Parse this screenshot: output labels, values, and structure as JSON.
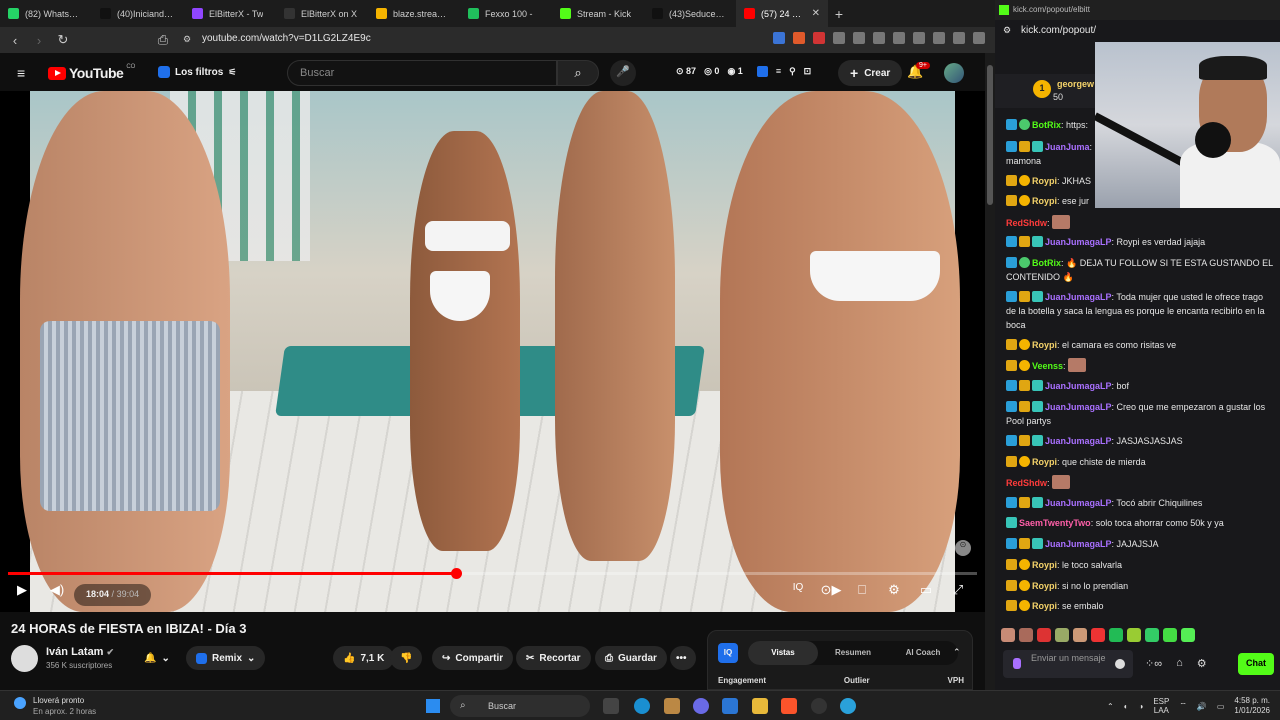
{
  "browser": {
    "tabs": [
      {
        "label": "(82) WhatsApp",
        "color": "#25d366"
      },
      {
        "label": "(40)Iniciando mi",
        "color": "#111111"
      },
      {
        "label": "ElBitterX - Tw",
        "color": "#9146ff"
      },
      {
        "label": "ElBitterX on X",
        "color": "#333333"
      },
      {
        "label": "blaze.stream/stre",
        "color": "#f5b400"
      },
      {
        "label": "Fexxo 100 -",
        "color": "#20c05c"
      },
      {
        "label": "Stream - Kick",
        "color": "#53fc18"
      },
      {
        "label": "(43)SeduceLaVid",
        "color": "#111111"
      },
      {
        "label": "(57) 24 HOR",
        "color": "#ff0000"
      }
    ],
    "new_tab": "+",
    "url": "youtube.com/watch?v=D1LG2LZ4E9c",
    "window_controls": [
      "–",
      "☐",
      "✕"
    ]
  },
  "youtube": {
    "logo_text": "YouTube",
    "logo_country": "CO",
    "filters_label": "Los filtros",
    "search_placeholder": "Buscar",
    "stats": {
      "views": "87",
      "zero": "0",
      "one": "1"
    },
    "create_label": "Crear",
    "notif_badge": "9+",
    "video": {
      "time_current": "18:04",
      "time_total": "39:04",
      "progress": 0.4625
    },
    "title": "24 HORAS de FIESTA en IBIZA! - Día 3",
    "channel": {
      "name": "Iván Latam",
      "subs": "356 K suscriptores"
    },
    "remix_label": "Remix",
    "likes": "7,1 K",
    "share_label": "Compartir",
    "clip_label": "Recortar",
    "save_label": "Guardar",
    "iq_panel": {
      "logo": "IQ",
      "tabs": [
        "Vistas",
        "Resumen",
        "AI Coach"
      ],
      "active_tab": "Vistas",
      "columns": [
        "Engagement",
        "Outlier",
        "VPH"
      ]
    }
  },
  "chat": {
    "popout_url": "kick.com/popout/elbitt",
    "popout_url2": "kick.com/popout/",
    "pinned": {
      "coin": "1",
      "user": "georgew",
      "value": "50"
    },
    "messages": [
      {
        "badges": [
          "b-blue",
          "b-green"
        ],
        "user": "BotRix",
        "user_color": "#53fc18",
        "text": "https:"
      },
      {
        "badges": [
          "b-blue",
          "b-gold",
          "b-teal"
        ],
        "user": "JuanJuma",
        "user_color": "#a970ff",
        "text": ""
      },
      {
        "badges": [],
        "user": "",
        "user_color": "#ffffff",
        "text": "mamona"
      },
      {
        "badges": [
          "b-gold",
          "b-coin"
        ],
        "user": "Roypi",
        "user_color": "#f5d36a",
        "text": "JKHAS"
      },
      {
        "badges": [
          "b-gold",
          "b-coin"
        ],
        "user": "Roypi",
        "user_color": "#f5d36a",
        "text": "ese jur"
      },
      {
        "badges": [],
        "user": "RedShdw",
        "user_color": "#ff3b3b",
        "text": "",
        "emote": true
      },
      {
        "badges": [
          "b-blue",
          "b-gold",
          "b-teal"
        ],
        "user": "JuanJumagaLP",
        "user_color": "#a970ff",
        "text": "Roypi es verdad jajaja"
      },
      {
        "badges": [
          "b-blue",
          "b-green"
        ],
        "user": "BotRix",
        "user_color": "#53fc18",
        "text": "🔥 DEJA TU FOLLOW SI TE ESTA GUSTANDO EL CONTENIDO 🔥"
      },
      {
        "badges": [
          "b-blue",
          "b-gold",
          "b-teal"
        ],
        "user": "JuanJumagaLP",
        "user_color": "#a970ff",
        "text": "Toda mujer que usted le ofrece trago de la botella y saca la lengua es porque le encanta recibirlo en la boca"
      },
      {
        "badges": [
          "b-gold",
          "b-coin"
        ],
        "user": "Roypi",
        "user_color": "#f5d36a",
        "text": "el camara es como risitas ve"
      },
      {
        "badges": [
          "b-gold",
          "b-coin"
        ],
        "user": "Veenss",
        "user_color": "#53fc18",
        "text": "",
        "emote": true
      },
      {
        "badges": [
          "b-blue",
          "b-gold",
          "b-teal"
        ],
        "user": "JuanJumagaLP",
        "user_color": "#a970ff",
        "text": "bof"
      },
      {
        "badges": [
          "b-blue",
          "b-gold",
          "b-teal"
        ],
        "user": "JuanJumagaLP",
        "user_color": "#a970ff",
        "text": "Creo que me empezaron a gustar los Pool partys"
      },
      {
        "badges": [
          "b-blue",
          "b-gold",
          "b-teal"
        ],
        "user": "JuanJumagaLP",
        "user_color": "#a970ff",
        "text": "JASJASJASJAS"
      },
      {
        "badges": [
          "b-gold",
          "b-coin"
        ],
        "user": "Roypi",
        "user_color": "#f5d36a",
        "text": "que chiste de mierda"
      },
      {
        "badges": [],
        "user": "RedShdw",
        "user_color": "#ff3b3b",
        "text": "",
        "emote": true
      },
      {
        "badges": [
          "b-blue",
          "b-gold",
          "b-teal"
        ],
        "user": "JuanJumagaLP",
        "user_color": "#a970ff",
        "text": "Tocó abrir Chiquilines"
      },
      {
        "badges": [
          "b-teal"
        ],
        "user": "SaemTwentyTwo",
        "user_color": "#ff5fa8",
        "text": "solo toca ahorrar como 50k y ya"
      },
      {
        "badges": [
          "b-blue",
          "b-gold",
          "b-teal"
        ],
        "user": "JuanJumagaLP",
        "user_color": "#a970ff",
        "text": "JAJAJSJA"
      },
      {
        "badges": [
          "b-gold",
          "b-coin"
        ],
        "user": "Roypi",
        "user_color": "#f5d36a",
        "text": "le toco salvarla"
      },
      {
        "badges": [
          "b-gold",
          "b-coin"
        ],
        "user": "Roypi",
        "user_color": "#f5d36a",
        "text": "si no lo prendian"
      },
      {
        "badges": [
          "b-gold",
          "b-coin"
        ],
        "user": "Roypi",
        "user_color": "#f5d36a",
        "text": "se embalo"
      }
    ],
    "input_placeholder": "Enviar un mensaje",
    "send_label": "Chat"
  },
  "taskbar": {
    "weather_line1": "Lloverá pronto",
    "weather_line2": "En aprox. 2 horas",
    "search_label": "Buscar",
    "lang_top": "ESP",
    "lang_bottom": "LAA",
    "time": "4:58 p. m.",
    "date": "1/01/2026"
  }
}
